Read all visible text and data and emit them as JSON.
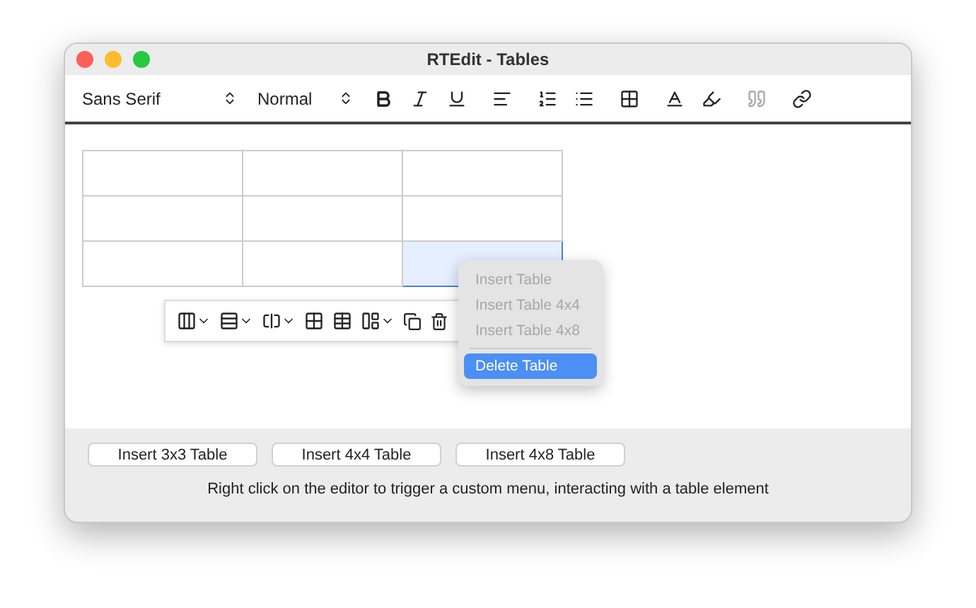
{
  "window": {
    "title": "RTEdit - Tables"
  },
  "toolbar": {
    "font": "Sans Serif",
    "size": "Normal",
    "quote_disabled": true
  },
  "table": {
    "rows": [
      [
        {
          "selected": false
        },
        {
          "selected": false
        },
        {
          "selected": false
        }
      ],
      [
        {
          "selected": false
        },
        {
          "selected": false
        },
        {
          "selected": false
        }
      ],
      [
        {
          "selected": false
        },
        {
          "selected": false
        },
        {
          "selected": true
        }
      ]
    ]
  },
  "context_menu": [
    {
      "label": "Insert Table",
      "disabled": true,
      "selected": false
    },
    {
      "label": "Insert Table 4x4",
      "disabled": true,
      "selected": false
    },
    {
      "label": "Insert Table 4x8",
      "disabled": true,
      "selected": false
    },
    {
      "label": "Delete Table",
      "disabled": false,
      "selected": true
    }
  ],
  "buttons": [
    "Insert 3x3 Table",
    "Insert 4x4 Table",
    "Insert 4x8 Table"
  ],
  "hint": "Right click on the editor to trigger a custom menu, interacting with a table element"
}
